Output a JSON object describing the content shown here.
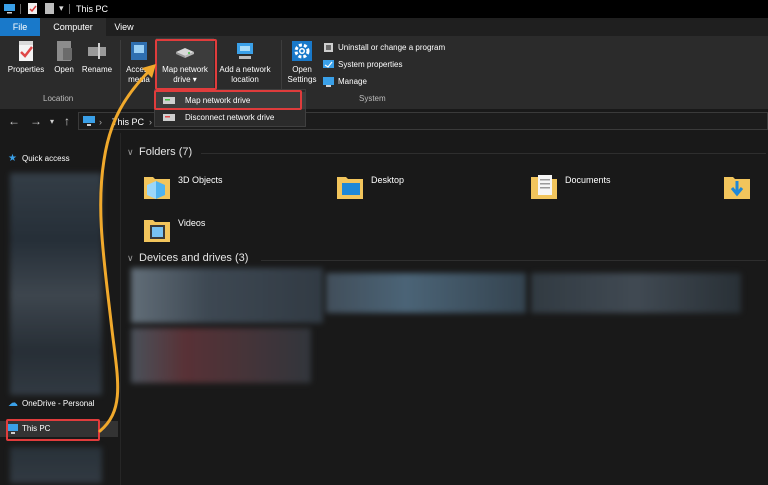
{
  "window": {
    "title": "This PC"
  },
  "tabs": [
    {
      "label": "File"
    },
    {
      "label": "Computer"
    },
    {
      "label": "View"
    }
  ],
  "ribbon": {
    "location_group": {
      "label": "Location",
      "buttons": [
        {
          "label": "Properties",
          "icon": "properties-check-icon"
        },
        {
          "label": "Open",
          "icon": "open-icon"
        },
        {
          "label": "Rename",
          "icon": "rename-icon"
        }
      ]
    },
    "network_group": {
      "access_media_line1": "Access",
      "access_media_line2": "media",
      "map_drive_line1": "Map network",
      "map_drive_line2": "drive",
      "add_location_line1": "Add a network",
      "add_location_line2": "location"
    },
    "system_group": {
      "label": "System",
      "open_settings_line1": "Open",
      "open_settings_line2": "Settings",
      "uninstall": "Uninstall or change a program",
      "system_properties": "System properties",
      "manage": "Manage"
    }
  },
  "dropdown": {
    "items": [
      {
        "label": "Map network drive",
        "icon": "network-drive-icon"
      },
      {
        "label": "Disconnect network drive",
        "icon": "disconnect-drive-icon"
      }
    ]
  },
  "address": {
    "crumb": "This PC"
  },
  "nav_pane": {
    "quick_access": "Quick access",
    "onedrive": "OneDrive - Personal",
    "this_pc": "This PC"
  },
  "content": {
    "folders_header": "Folders (7)",
    "folders": [
      {
        "label": "3D Objects",
        "icon": "3d-objects-folder-icon"
      },
      {
        "label": "Desktop",
        "icon": "desktop-folder-icon"
      },
      {
        "label": "Documents",
        "icon": "documents-folder-icon"
      },
      {
        "label": "Videos",
        "icon": "videos-folder-icon"
      }
    ],
    "devices_header": "Devices and drives (3)"
  },
  "colors": {
    "accent": "#1979ca",
    "highlight": "#e03c3c",
    "arrow": "#f0a92c",
    "background": "#191919",
    "ribbon": "#2b2b2b"
  }
}
